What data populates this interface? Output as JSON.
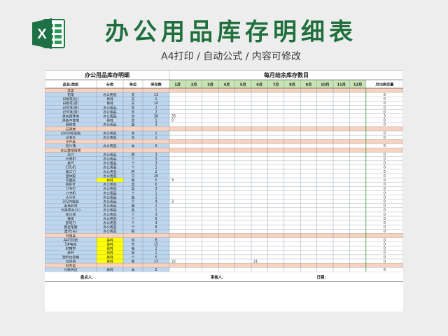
{
  "header": {
    "title": "办公用品库存明细表",
    "subtitle": "A4打印 / 自动公式 / 内容可修改",
    "logo_icon": "excel-icon"
  },
  "sheet": {
    "left_title": "办公用品库存明细",
    "right_title": "每月结余库存数目",
    "columns": [
      "品名/类别",
      "分类",
      "单位",
      "库存数"
    ],
    "months": [
      "1月",
      "2月",
      "3月",
      "4月",
      "5月",
      "6月",
      "7月",
      "8月",
      "9月",
      "10月",
      "11月",
      "12月"
    ],
    "avg_label": "月均库存量",
    "rows": [
      {
        "name": "笔类",
        "section": true
      },
      {
        "name": "铅笔",
        "cat": "办公用品",
        "unit": "支",
        "qty": "13",
        "avg": "0"
      },
      {
        "name": "白板笔(红)",
        "cat": "易耗",
        "unit": "支",
        "qty": "1",
        "avg": "0"
      },
      {
        "name": "白板笔(黑)",
        "cat": "易耗",
        "unit": "支",
        "qty": "10",
        "avg": "0"
      },
      {
        "name": "记号笔(黑)",
        "cat": "办公用品",
        "unit": "支",
        "qty": "2",
        "avg": "0"
      },
      {
        "name": "记号笔(蓝)",
        "cat": "办公用品",
        "unit": "支",
        "qty": "2",
        "avg": "0"
      },
      {
        "name": "黑色圆珠笔",
        "cat": "办公用品",
        "unit": "支",
        "qty": "38",
        "m": {
          "0": "35"
        },
        "avg": "3"
      },
      {
        "name": "黑色中性笔",
        "cat": "易耗",
        "unit": "支",
        "qty": "1",
        "m": {
          "0": "0"
        },
        "avg": "0"
      },
      {
        "name": "圆珠笔",
        "cat": "办公用品",
        "unit": "盒",
        "qty": "3",
        "avg": "0"
      },
      {
        "name": "记录类",
        "section": true
      },
      {
        "name": "LOGO标签贴",
        "cat": "办公用品",
        "unit": "本",
        "qty": "1",
        "avg": "0"
      },
      {
        "name": "记事本",
        "cat": "办公用品",
        "unit": "本",
        "qty": "1",
        "avg": "0"
      },
      {
        "name": "文件类",
        "section": true
      },
      {
        "name": "名片簿",
        "cat": "办公用品",
        "unit": "本",
        "qty": "2",
        "avg": "0"
      },
      {
        "name": "办公室常用类",
        "section": true
      },
      {
        "name": "剪刀",
        "cat": "办公用品",
        "unit": "把",
        "qty": "3",
        "avg": "0"
      },
      {
        "name": "计算机",
        "cat": "办公用品",
        "unit": "个",
        "qty": "3",
        "avg": "0"
      },
      {
        "name": "卷尺",
        "cat": "办公用品",
        "unit": "个",
        "qty": "3",
        "avg": "0"
      },
      {
        "name": "打孔机",
        "cat": "办公用品",
        "unit": "个",
        "qty": "1",
        "avg": "0"
      },
      {
        "name": "美工刀",
        "cat": "办公用品",
        "unit": "把",
        "qty": "2",
        "avg": "0"
      },
      {
        "name": "固体胶",
        "cat": "办公用品",
        "unit": "只",
        "qty": "26",
        "avg": "0"
      },
      {
        "name": "双面胶",
        "cat": "易耗",
        "yellow": true,
        "unit": "卷",
        "qty": "5",
        "m": {
          "0": "3"
        },
        "avg": "0"
      },
      {
        "name": "回形针",
        "cat": "办公用品",
        "unit": "盒",
        "qty": "6",
        "avg": "0"
      },
      {
        "name": "订书钉",
        "cat": "办公用品",
        "unit": "盒",
        "qty": "3",
        "avg": "0"
      },
      {
        "name": "订书机",
        "cat": "办公用品",
        "unit": "个",
        "qty": "1",
        "avg": "0"
      },
      {
        "name": "大头针",
        "cat": "办公用品",
        "unit": "盒",
        "qty": "1",
        "avg": "0"
      },
      {
        "name": "502万能胶",
        "cat": "办公用品",
        "unit": "个",
        "qty": "4",
        "m": {
          "0": "3"
        },
        "avg": "0"
      },
      {
        "name": "金色彩带",
        "cat": "办公用品",
        "unit": "卷",
        "qty": "1",
        "avg": "0"
      },
      {
        "name": "长尾票夹(小)",
        "cat": "办公用品",
        "unit": "盒",
        "qty": "1",
        "avg": "0"
      },
      {
        "name": "修正液",
        "cat": "办公用品",
        "unit": "个",
        "qty": "3",
        "avg": "0"
      },
      {
        "name": "橡皮",
        "cat": "办公用品",
        "unit": "个",
        "qty": "6",
        "avg": "0"
      },
      {
        "name": "卷笔刀",
        "cat": "办公用品",
        "unit": "个",
        "qty": "3",
        "avg": "0"
      },
      {
        "name": "钢丝笔圈",
        "cat": "办公用品",
        "unit": "个",
        "qty": "8",
        "avg": "0"
      },
      {
        "name": "直尺(长)",
        "cat": "办公用品",
        "unit": "把",
        "qty": "1",
        "avg": "0"
      },
      {
        "name": "日用品",
        "section": true
      },
      {
        "name": "A4打印纸",
        "cat": "易耗",
        "yellow": true,
        "unit": "包",
        "qty": "8",
        "avg": "0"
      },
      {
        "name": "5#电池",
        "cat": "易耗",
        "yellow": true,
        "unit": "节",
        "qty": "15",
        "avg": "0"
      },
      {
        "name": "封箱带",
        "cat": "易耗",
        "yellow": true,
        "unit": "卷",
        "qty": "2",
        "avg": "0"
      },
      {
        "name": "纸杯",
        "cat": "易耗",
        "yellow": true,
        "unit": "包",
        "qty": "1",
        "avg": "0"
      },
      {
        "name": "塑料垃圾桶",
        "cat": "易耗",
        "yellow": true,
        "unit": "个",
        "qty": "5",
        "avg": "0"
      },
      {
        "name": "垃圾袋",
        "cat": "易耗",
        "yellow": true,
        "unit": "卷",
        "qty": "23",
        "m": {
          "0": "22",
          "5": "21"
        },
        "avg": "0"
      },
      {
        "name": "财务类",
        "section": true
      },
      {
        "name": "付款凭证",
        "cat": "易耗",
        "unit": "本",
        "qty": "2",
        "avg": "0"
      }
    ],
    "footer": {
      "counter": "盘点人:",
      "reviewer": "审核人:",
      "date": "日期:"
    }
  },
  "colors": {
    "title_green": "#1f6f3d",
    "month_header_green": "#c8e3b4",
    "section_orange": "#f8d2bf",
    "name_blue": "#bdd6ee",
    "highlight_yellow": "#ffff00",
    "avg_red": "#e00000"
  }
}
